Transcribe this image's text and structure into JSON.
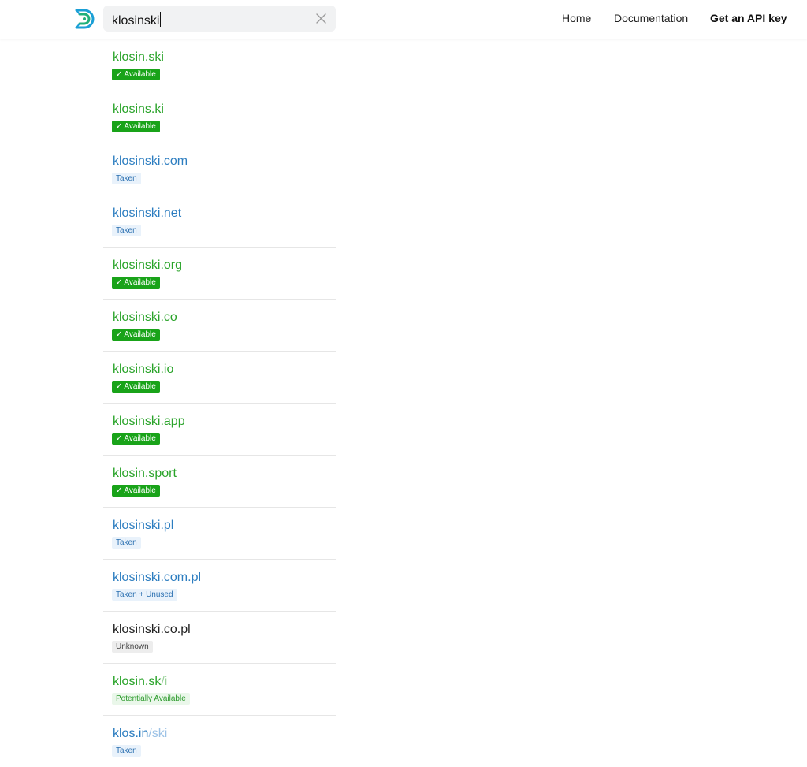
{
  "header": {
    "search_value": "klosinski",
    "nav": {
      "home": "Home",
      "docs": "Documentation",
      "api_key": "Get an API key"
    }
  },
  "colors": {
    "available": "#19a319",
    "taken": "#2c7dc0",
    "unknown": "#222222"
  },
  "results": [
    {
      "domain": "klosin.ski",
      "rest": "",
      "status": "Available",
      "type": "available"
    },
    {
      "domain": "klosins.ki",
      "rest": "",
      "status": "Available",
      "type": "available"
    },
    {
      "domain": "klosinski.com",
      "rest": "",
      "status": "Taken",
      "type": "taken"
    },
    {
      "domain": "klosinski.net",
      "rest": "",
      "status": "Taken",
      "type": "taken"
    },
    {
      "domain": "klosinski.org",
      "rest": "",
      "status": "Available",
      "type": "available"
    },
    {
      "domain": "klosinski.co",
      "rest": "",
      "status": "Available",
      "type": "available"
    },
    {
      "domain": "klosinski.io",
      "rest": "",
      "status": "Available",
      "type": "available"
    },
    {
      "domain": "klosinski.app",
      "rest": "",
      "status": "Available",
      "type": "available"
    },
    {
      "domain": "klosin.sport",
      "rest": "",
      "status": "Available",
      "type": "available"
    },
    {
      "domain": "klosinski.pl",
      "rest": "",
      "status": "Taken",
      "type": "taken"
    },
    {
      "domain": "klosinski.com.pl",
      "rest": "",
      "status": "Taken + Unused",
      "type": "taken"
    },
    {
      "domain": "klosinski.co.pl",
      "rest": "",
      "status": "Unknown",
      "type": "unknown"
    },
    {
      "domain": "klosin.sk",
      "rest": "/i",
      "status": "Potentially Available",
      "type": "potential"
    },
    {
      "domain": "klos.in",
      "rest": "/ski",
      "status": "Taken",
      "type": "taken-faded"
    }
  ]
}
